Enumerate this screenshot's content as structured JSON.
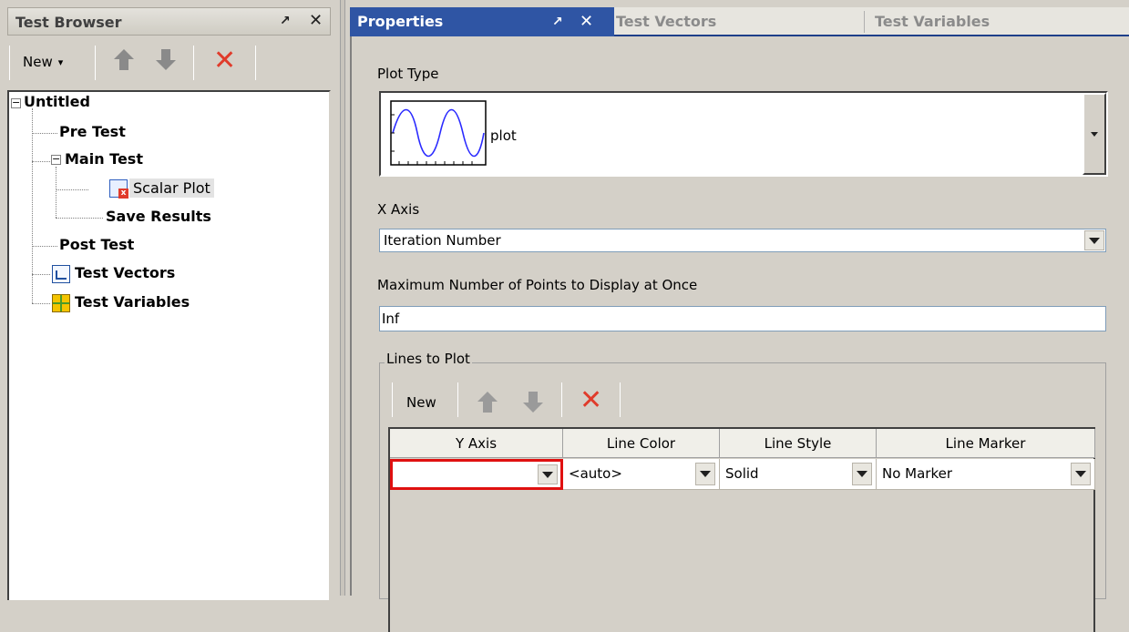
{
  "left_pane": {
    "title": "Test Browser",
    "pin_glyph": "↗",
    "close_glyph": "✕",
    "toolbar": {
      "new_label": "New",
      "new_dropdown_glyph": "▾"
    },
    "tree": {
      "root": {
        "label": "Untitled",
        "expander": "−"
      },
      "pre_test": "Pre Test",
      "main_test": {
        "label": "Main Test",
        "expander": "−"
      },
      "scalar_plot": "Scalar Plot",
      "save_results": "Save Results",
      "post_test": "Post Test",
      "test_vectors": "Test Vectors",
      "test_variables": "Test Variables"
    }
  },
  "tabs": {
    "properties": "Properties",
    "test_vectors": "Test Vectors",
    "test_variables": "Test Variables"
  },
  "properties": {
    "plot_type_label": "Plot Type",
    "plot_type_value": "plot",
    "x_axis_label": "X Axis",
    "x_axis_value": "Iteration Number",
    "max_points_label": "Maximum Number of Points to Display at Once",
    "max_points_value": "Inf",
    "lines_group_label": "Lines to Plot",
    "lines_toolbar": {
      "new_label": "New"
    },
    "grid": {
      "headers": [
        "Y Axis",
        "Line Color",
        "Line Style",
        "Line Marker"
      ],
      "rows": [
        {
          "y_axis": "",
          "line_color": "<auto>",
          "line_style": "Solid",
          "line_marker": "No Marker"
        }
      ]
    }
  },
  "colors": {
    "active_tab": "#2f55a4",
    "delete_red": "#e03b2b",
    "invalid_border": "#e01010"
  }
}
